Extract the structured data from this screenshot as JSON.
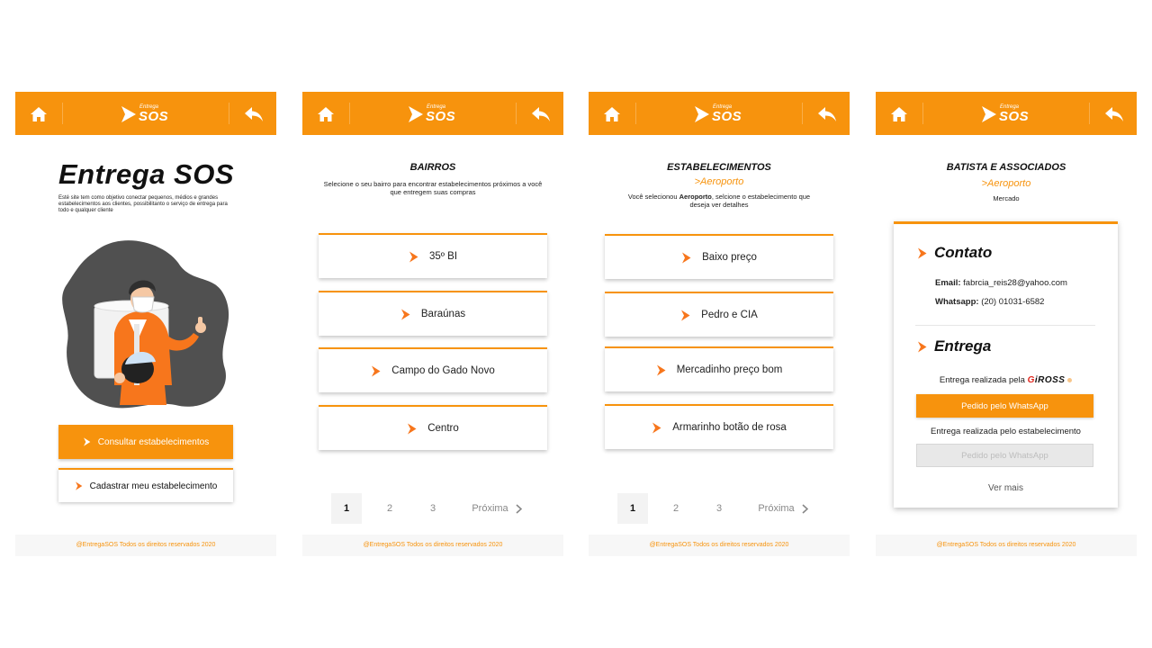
{
  "common": {
    "logo_small": "Entrega",
    "logo_big": "SOS",
    "footer": "@EntregaSOS Todos os direitos reservados 2020"
  },
  "home": {
    "title": "Entrega SOS",
    "description": "Esté site tem como objetivo conectar pequenos, médios e grandes estabelecimentos aos clientes, possibilitanto o serviço de entrega para todo e qualquer cliente",
    "primary_button": "Consultar estabelecimentos",
    "secondary_button": "Cadastrar meu estabelecimento"
  },
  "bairros": {
    "title": "BAIRROS",
    "subtitle": "Selecione o seu bairro para encontrar estabelecimentos próximos a você que entregem suas compras",
    "items": [
      "35º BI",
      "Baraúnas",
      "Campo do Gado Novo",
      "Centro"
    ],
    "pages": [
      "1",
      "2",
      "3"
    ],
    "next_label": "Próxima"
  },
  "estabelecimentos": {
    "title": "ESTABELECIMENTOS",
    "selected": ">Aeroporto",
    "subtitle_pre": "Você selecionou ",
    "subtitle_bold": "Aeroporto",
    "subtitle_post": ", selcione o estabelecimento que deseja ver detalhes",
    "items": [
      "Baixo preço",
      "Pedro e CIA",
      "Mercadinho preço bom",
      "Armarinho botão de rosa"
    ],
    "pages": [
      "1",
      "2",
      "3"
    ],
    "next_label": "Próxima"
  },
  "detalhe": {
    "name": "BATISTA E ASSOCIADOS",
    "bairro": ">Aeroporto",
    "category": "Mercado",
    "contato_heading": "Contato",
    "email_label": "Email:",
    "email_value": "fabrcia_reis28@yahoo.com",
    "whatsapp_label": "Whatsapp:",
    "whatsapp_value": "(20) 01031-6582",
    "entrega_heading": "Entrega",
    "giross_text": "Entrega realizada pela",
    "giross_logo_g": "G",
    "giross_logo_rest": "iROSS",
    "button_whatsapp_1": "Pedido pelo WhatsApp",
    "estab_text": "Entrega realizada pelo estabelecimento",
    "button_whatsapp_2": "Pedido pelo WhatsApp",
    "ver_mais": "Ver mais"
  },
  "colors": {
    "accent": "#f7930d",
    "footer_bg": "#f7f7f7"
  },
  "icons": {
    "home": "home-icon",
    "back": "back-arrow-icon",
    "chevron": "chevron-right-icon"
  }
}
